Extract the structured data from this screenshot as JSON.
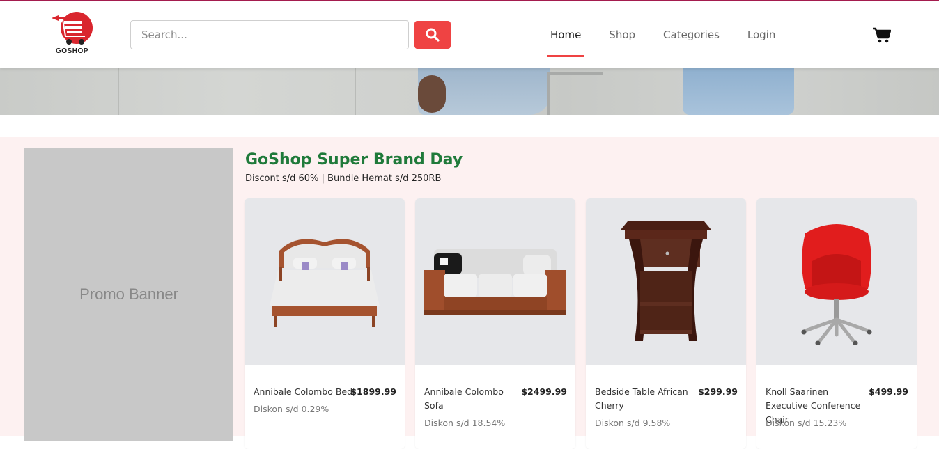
{
  "header": {
    "logo_text": "GOSHOP",
    "search": {
      "placeholder": "Search...",
      "value": ""
    },
    "nav": [
      {
        "label": "Home",
        "active": true
      },
      {
        "label": "Shop",
        "active": false
      },
      {
        "label": "Categories",
        "active": false
      },
      {
        "label": "Login",
        "active": false
      }
    ],
    "icons": {
      "search": "search-icon",
      "cart": "cart-icon"
    }
  },
  "promo": {
    "label": "Promo Banner"
  },
  "section": {
    "title": "GoShop Super Brand Day",
    "subtitle": "Discont s/d 60% | Bundle Hemat s/d 250RB"
  },
  "products": [
    {
      "name": "Annibale Colombo Bed",
      "price": "$1899.99",
      "discount": "Diskon s/d 0.29%",
      "image": "bed"
    },
    {
      "name": "Annibale Colombo Sofa",
      "price": "$2499.99",
      "discount": "Diskon s/d 18.54%",
      "image": "sofa"
    },
    {
      "name": "Bedside Table African Cherry",
      "price": "$299.99",
      "discount": "Diskon s/d 9.58%",
      "image": "bedside-table"
    },
    {
      "name": "Knoll Saarinen Executive Conference Chair",
      "price": "$499.99",
      "discount": "Diskon s/d 15.23%",
      "image": "office-chair"
    }
  ],
  "colors": {
    "accent": "#ef4343",
    "title_green": "#1f7a3a",
    "section_bg": "#fdf1f1",
    "top_line": "#a51d4f"
  }
}
